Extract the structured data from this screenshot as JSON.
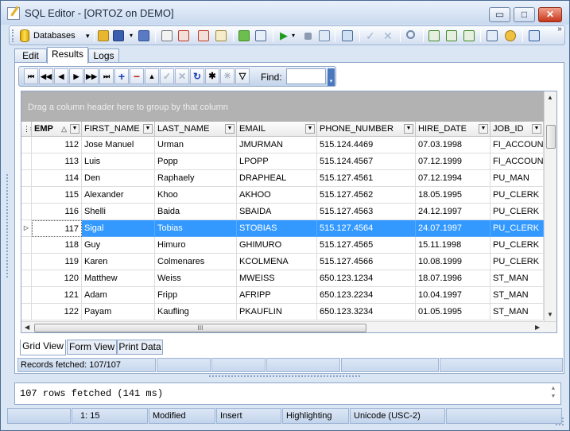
{
  "window": {
    "title": "SQL Editor - [ORTOZ on DEMO]",
    "minimize_glyph": "▭",
    "maximize_glyph": "□",
    "close_glyph": "✕"
  },
  "toolbar": {
    "databases_label": "Databases",
    "dropdown_glyph": "▾",
    "more_glyph": "»"
  },
  "tabs": [
    {
      "label": "Edit"
    },
    {
      "label": "Results"
    },
    {
      "label": "Logs"
    }
  ],
  "navigator": {
    "buttons": [
      {
        "name": "first-page",
        "glyph": "⏮",
        "enabled": true
      },
      {
        "name": "prior-page",
        "glyph": "◀◀",
        "enabled": true
      },
      {
        "name": "prior",
        "glyph": "◀",
        "enabled": true
      },
      {
        "name": "next",
        "glyph": "▶",
        "enabled": true
      },
      {
        "name": "next-page",
        "glyph": "▶▶",
        "enabled": true
      },
      {
        "name": "last-page",
        "glyph": "⏭",
        "enabled": true
      },
      {
        "name": "insert",
        "glyph": "+",
        "enabled": true
      },
      {
        "name": "delete",
        "glyph": "−",
        "enabled": true
      },
      {
        "name": "edit",
        "glyph": "▲",
        "enabled": true
      },
      {
        "name": "post",
        "glyph": "✓",
        "enabled": false
      },
      {
        "name": "cancel",
        "glyph": "✕",
        "enabled": false
      },
      {
        "name": "refresh",
        "glyph": "↻",
        "enabled": true
      },
      {
        "name": "set-bookmark",
        "glyph": "✱",
        "enabled": true
      },
      {
        "name": "goto-bookmark",
        "glyph": "✳",
        "enabled": false
      },
      {
        "name": "filter",
        "glyph": "▽",
        "enabled": true
      }
    ],
    "find_label": "Find:",
    "find_value": ""
  },
  "grid": {
    "group_panel_text": "Drag a column header here to group by that column",
    "columns": [
      "EMP",
      "FIRST_NAME",
      "LAST_NAME",
      "EMAIL",
      "PHONE_NUMBER",
      "HIRE_DATE",
      "JOB_ID"
    ],
    "sorted_column": "EMP",
    "sort_glyph": "△",
    "filter_glyph": "▼",
    "current_row_glyph": "▷",
    "rows": [
      [
        "112",
        "Jose Manuel",
        "Urman",
        "JMURMAN",
        "515.124.4469",
        "07.03.1998",
        "FI_ACCOUNT"
      ],
      [
        "113",
        "Luis",
        "Popp",
        "LPOPP",
        "515.124.4567",
        "07.12.1999",
        "FI_ACCOUNT"
      ],
      [
        "114",
        "Den",
        "Raphaely",
        "DRAPHEAL",
        "515.127.4561",
        "07.12.1994",
        "PU_MAN"
      ],
      [
        "115",
        "Alexander",
        "Khoo",
        "AKHOO",
        "515.127.4562",
        "18.05.1995",
        "PU_CLERK"
      ],
      [
        "116",
        "Shelli",
        "Baida",
        "SBAIDA",
        "515.127.4563",
        "24.12.1997",
        "PU_CLERK"
      ],
      [
        "117",
        "Sigal",
        "Tobias",
        "STOBIAS",
        "515.127.4564",
        "24.07.1997",
        "PU_CLERK"
      ],
      [
        "118",
        "Guy",
        "Himuro",
        "GHIMURO",
        "515.127.4565",
        "15.11.1998",
        "PU_CLERK"
      ],
      [
        "119",
        "Karen",
        "Colmenares",
        "KCOLMENA",
        "515.127.4566",
        "10.08.1999",
        "PU_CLERK"
      ],
      [
        "120",
        "Matthew",
        "Weiss",
        "MWEISS",
        "650.123.1234",
        "18.07.1996",
        "ST_MAN"
      ],
      [
        "121",
        "Adam",
        "Fripp",
        "AFRIPP",
        "650.123.2234",
        "10.04.1997",
        "ST_MAN"
      ],
      [
        "122",
        "Payam",
        "Kaufling",
        "PKAUFLIN",
        "650.123.3234",
        "01.05.1995",
        "ST_MAN"
      ]
    ],
    "selected_row": 5,
    "scroll_glyphs": {
      "up": "▲",
      "down": "▼",
      "left": "◀",
      "right": "▶",
      "grip": "III"
    }
  },
  "view_tabs": [
    {
      "label": "Grid View"
    },
    {
      "label": "Form View"
    },
    {
      "label": "Print Data"
    }
  ],
  "status_top": {
    "records": "Records fetched: 107/107"
  },
  "message": {
    "text": "107 rows fetched (141 ms)"
  },
  "status_bottom": {
    "position": "1:  15",
    "state": "Modified",
    "mode": "Insert",
    "highlighting": "Highlighting",
    "encoding": "Unicode (USC-2)"
  }
}
